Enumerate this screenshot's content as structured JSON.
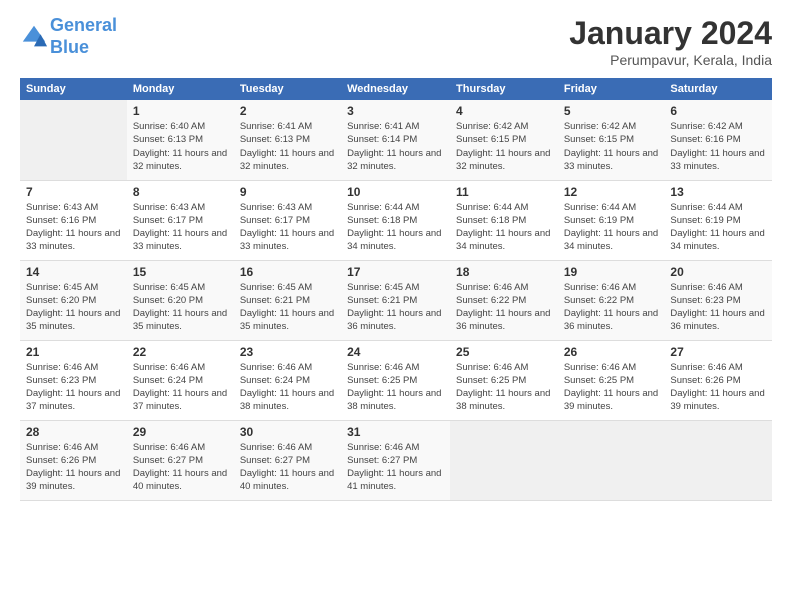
{
  "logo": {
    "line1": "General",
    "line2": "Blue"
  },
  "header": {
    "title": "January 2024",
    "location": "Perumpavur, Kerala, India"
  },
  "weekdays": [
    "Sunday",
    "Monday",
    "Tuesday",
    "Wednesday",
    "Thursday",
    "Friday",
    "Saturday"
  ],
  "weeks": [
    [
      {
        "day": "",
        "info": ""
      },
      {
        "day": "1",
        "info": "Sunrise: 6:40 AM\nSunset: 6:13 PM\nDaylight: 11 hours\nand 32 minutes."
      },
      {
        "day": "2",
        "info": "Sunrise: 6:41 AM\nSunset: 6:13 PM\nDaylight: 11 hours\nand 32 minutes."
      },
      {
        "day": "3",
        "info": "Sunrise: 6:41 AM\nSunset: 6:14 PM\nDaylight: 11 hours\nand 32 minutes."
      },
      {
        "day": "4",
        "info": "Sunrise: 6:42 AM\nSunset: 6:15 PM\nDaylight: 11 hours\nand 32 minutes."
      },
      {
        "day": "5",
        "info": "Sunrise: 6:42 AM\nSunset: 6:15 PM\nDaylight: 11 hours\nand 33 minutes."
      },
      {
        "day": "6",
        "info": "Sunrise: 6:42 AM\nSunset: 6:16 PM\nDaylight: 11 hours\nand 33 minutes."
      }
    ],
    [
      {
        "day": "7",
        "info": "Sunrise: 6:43 AM\nSunset: 6:16 PM\nDaylight: 11 hours\nand 33 minutes."
      },
      {
        "day": "8",
        "info": "Sunrise: 6:43 AM\nSunset: 6:17 PM\nDaylight: 11 hours\nand 33 minutes."
      },
      {
        "day": "9",
        "info": "Sunrise: 6:43 AM\nSunset: 6:17 PM\nDaylight: 11 hours\nand 33 minutes."
      },
      {
        "day": "10",
        "info": "Sunrise: 6:44 AM\nSunset: 6:18 PM\nDaylight: 11 hours\nand 34 minutes."
      },
      {
        "day": "11",
        "info": "Sunrise: 6:44 AM\nSunset: 6:18 PM\nDaylight: 11 hours\nand 34 minutes."
      },
      {
        "day": "12",
        "info": "Sunrise: 6:44 AM\nSunset: 6:19 PM\nDaylight: 11 hours\nand 34 minutes."
      },
      {
        "day": "13",
        "info": "Sunrise: 6:44 AM\nSunset: 6:19 PM\nDaylight: 11 hours\nand 34 minutes."
      }
    ],
    [
      {
        "day": "14",
        "info": "Sunrise: 6:45 AM\nSunset: 6:20 PM\nDaylight: 11 hours\nand 35 minutes."
      },
      {
        "day": "15",
        "info": "Sunrise: 6:45 AM\nSunset: 6:20 PM\nDaylight: 11 hours\nand 35 minutes."
      },
      {
        "day": "16",
        "info": "Sunrise: 6:45 AM\nSunset: 6:21 PM\nDaylight: 11 hours\nand 35 minutes."
      },
      {
        "day": "17",
        "info": "Sunrise: 6:45 AM\nSunset: 6:21 PM\nDaylight: 11 hours\nand 36 minutes."
      },
      {
        "day": "18",
        "info": "Sunrise: 6:46 AM\nSunset: 6:22 PM\nDaylight: 11 hours\nand 36 minutes."
      },
      {
        "day": "19",
        "info": "Sunrise: 6:46 AM\nSunset: 6:22 PM\nDaylight: 11 hours\nand 36 minutes."
      },
      {
        "day": "20",
        "info": "Sunrise: 6:46 AM\nSunset: 6:23 PM\nDaylight: 11 hours\nand 36 minutes."
      }
    ],
    [
      {
        "day": "21",
        "info": "Sunrise: 6:46 AM\nSunset: 6:23 PM\nDaylight: 11 hours\nand 37 minutes."
      },
      {
        "day": "22",
        "info": "Sunrise: 6:46 AM\nSunset: 6:24 PM\nDaylight: 11 hours\nand 37 minutes."
      },
      {
        "day": "23",
        "info": "Sunrise: 6:46 AM\nSunset: 6:24 PM\nDaylight: 11 hours\nand 38 minutes."
      },
      {
        "day": "24",
        "info": "Sunrise: 6:46 AM\nSunset: 6:25 PM\nDaylight: 11 hours\nand 38 minutes."
      },
      {
        "day": "25",
        "info": "Sunrise: 6:46 AM\nSunset: 6:25 PM\nDaylight: 11 hours\nand 38 minutes."
      },
      {
        "day": "26",
        "info": "Sunrise: 6:46 AM\nSunset: 6:25 PM\nDaylight: 11 hours\nand 39 minutes."
      },
      {
        "day": "27",
        "info": "Sunrise: 6:46 AM\nSunset: 6:26 PM\nDaylight: 11 hours\nand 39 minutes."
      }
    ],
    [
      {
        "day": "28",
        "info": "Sunrise: 6:46 AM\nSunset: 6:26 PM\nDaylight: 11 hours\nand 39 minutes."
      },
      {
        "day": "29",
        "info": "Sunrise: 6:46 AM\nSunset: 6:27 PM\nDaylight: 11 hours\nand 40 minutes."
      },
      {
        "day": "30",
        "info": "Sunrise: 6:46 AM\nSunset: 6:27 PM\nDaylight: 11 hours\nand 40 minutes."
      },
      {
        "day": "31",
        "info": "Sunrise: 6:46 AM\nSunset: 6:27 PM\nDaylight: 11 hours\nand 41 minutes."
      },
      {
        "day": "",
        "info": ""
      },
      {
        "day": "",
        "info": ""
      },
      {
        "day": "",
        "info": ""
      }
    ]
  ]
}
